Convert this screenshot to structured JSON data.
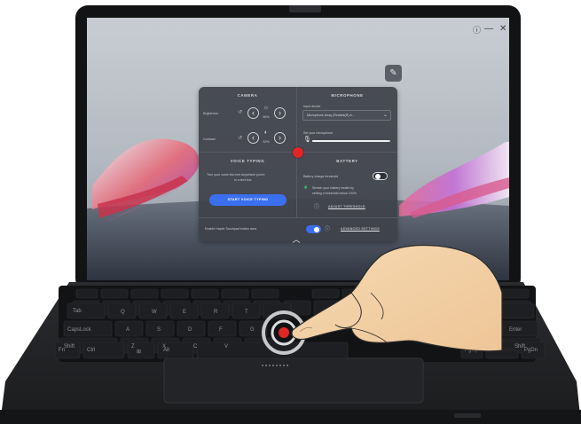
{
  "overlay": {
    "camera": {
      "title": "CAMERA",
      "brightness_label": "Brightness",
      "brightness_value": "56%",
      "contrast_label": "Contrast",
      "contrast_value": "32%"
    },
    "microphone": {
      "title": "MICROPHONE",
      "input_label": "Input device",
      "input_device": "Microphone Array (Realtek(R) A...",
      "volume_label": "Set your microphone",
      "volume_level": 0.98
    },
    "voice_typing": {
      "title": "VOICE TYPING",
      "description_line1": "Turn your voice into text anywhere you're",
      "description_line2": "in a text box.",
      "button_label": "START VOICE TYPING"
    },
    "battery": {
      "title": "BATTERY",
      "charge_threshold_label": "Battery charge threshold",
      "charge_threshold_on": false,
      "tip_line1": "Stretch your battery health by",
      "tip_line2": "setting a threshold below 100%",
      "adjust_link": "ADJUST THRESHOLD"
    },
    "footer": {
      "haptic_label": "Enable Haptic Touchpad button area",
      "haptic_on": true,
      "advanced_link": "ADVANCED SETTINGS"
    },
    "colors": {
      "accent": "#3a6ff0",
      "panel": "#3e424a",
      "touch_marker": "#e02626"
    }
  },
  "icons": {
    "close": "close-icon",
    "minimize": "minimize-icon",
    "info": "info-icon",
    "edit": "edit-icon"
  },
  "keyboard": {
    "row2": [
      "Tab",
      "Q",
      "W",
      "E",
      "R",
      "T",
      "Y",
      "U",
      "I",
      "O",
      "P",
      "[",
      "]",
      "\\"
    ],
    "row3": [
      "CapsLock",
      "A",
      "S",
      "D",
      "F",
      "G",
      "H",
      "J",
      "K",
      "L",
      ";",
      "'",
      "Enter"
    ],
    "row4": [
      "Shift",
      "Z",
      "X",
      "C",
      "V",
      "B",
      "N",
      "M",
      ",",
      ".",
      "/",
      "Shift"
    ],
    "row5": [
      "Fn",
      "Ctrl",
      "⊞",
      "Alt",
      "",
      "Alt",
      "",
      "Ctrl",
      "PgUp",
      "",
      "PgDn"
    ]
  }
}
